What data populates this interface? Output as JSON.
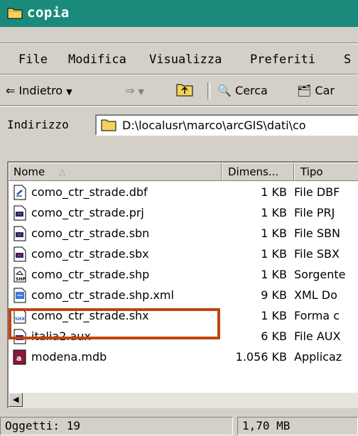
{
  "window": {
    "title": "copia"
  },
  "menu": {
    "items": [
      "File",
      "Modifica",
      "Visualizza",
      "Preferiti",
      "S"
    ]
  },
  "toolbar": {
    "back": "Indietro",
    "search": "Cerca",
    "folders": "Car"
  },
  "address": {
    "label": "Indirizzo",
    "value": "D:\\localusr\\marco\\arcGIS\\dati\\co"
  },
  "columns": {
    "name": "Nome",
    "size": "Dimens...",
    "type": "Tipo"
  },
  "files": [
    {
      "name": "como_ctr_strade.dbf",
      "size": "1 KB",
      "type": "File DBF",
      "icon": "dbf-file-icon"
    },
    {
      "name": "como_ctr_strade.prj",
      "size": "1 KB",
      "type": "File PRJ",
      "icon": "generic-file-icon"
    },
    {
      "name": "como_ctr_strade.sbn",
      "size": "1 KB",
      "type": "File SBN",
      "icon": "generic-file-icon"
    },
    {
      "name": "como_ctr_strade.sbx",
      "size": "1 KB",
      "type": "File SBX",
      "icon": "generic-file-icon"
    },
    {
      "name": "como_ctr_strade.shp",
      "size": "1 KB",
      "type": "Sorgente",
      "icon": "shp-file-icon"
    },
    {
      "name": "como_ctr_strade.shp.xml",
      "size": "9 KB",
      "type": "XML Do",
      "icon": "xml-file-icon"
    },
    {
      "name": "como_ctr_strade.shx",
      "size": "1 KB",
      "type": "Forma c",
      "icon": "shx-file-icon"
    },
    {
      "name": "italia2.aux",
      "size": "6 KB",
      "type": "File AUX",
      "icon": "generic-file-icon"
    },
    {
      "name": "modena.mdb",
      "size": "1.056 KB",
      "type": "Applicaz",
      "icon": "mdb-file-icon"
    }
  ],
  "status": {
    "objects": "Oggetti: 19",
    "size": "1,70 MB"
  },
  "colors": {
    "titlebar": "#1a8a7c",
    "highlight": "#c0430f",
    "face": "#d4d0c8"
  }
}
